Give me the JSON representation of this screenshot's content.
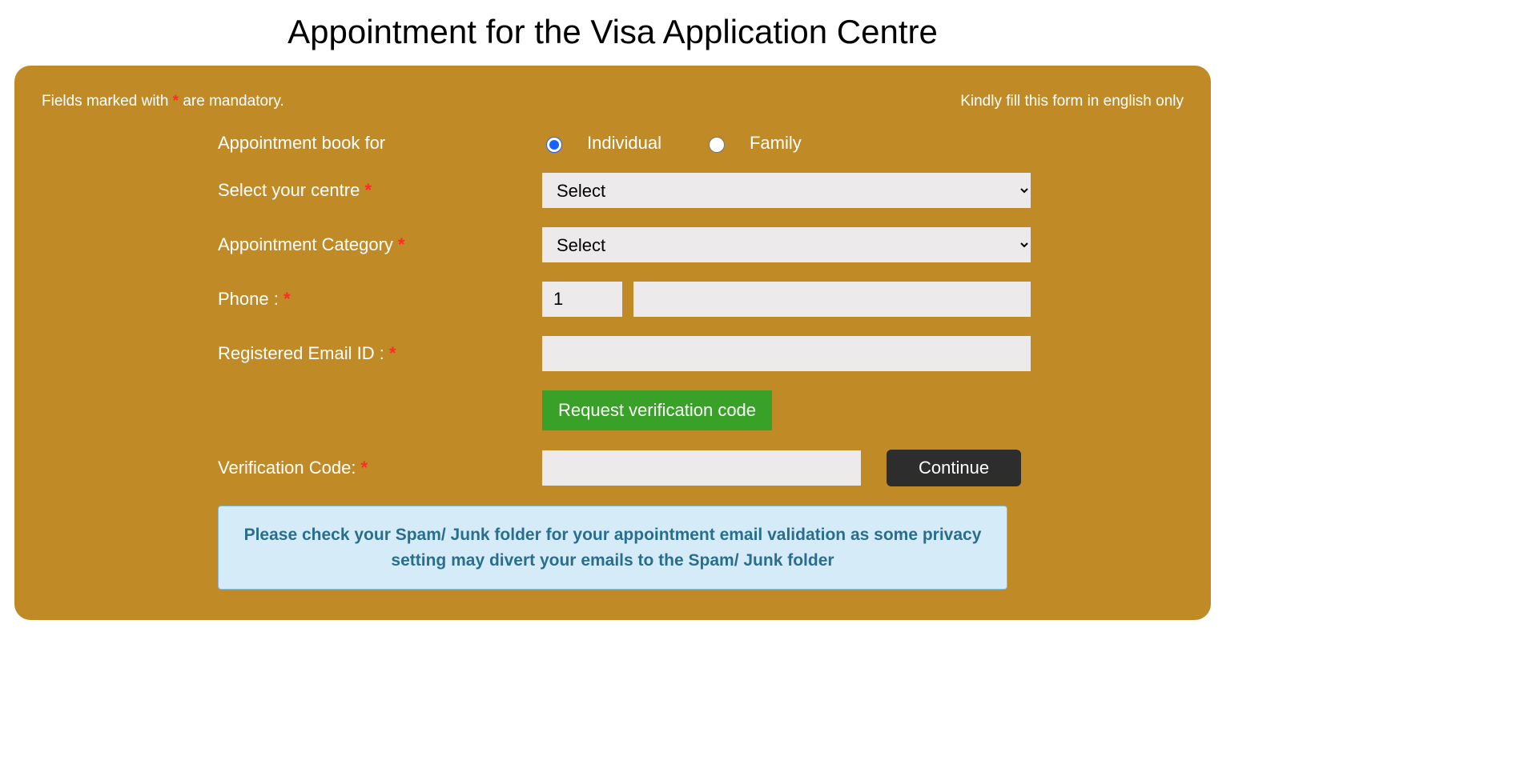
{
  "title": "Appointment for the Visa Application Centre",
  "top": {
    "mandatory_prefix": "Fields marked with ",
    "mandatory_star": "*",
    "mandatory_suffix": " are mandatory.",
    "english_note": "Kindly fill this form in english only"
  },
  "labels": {
    "book_for": "Appointment book for",
    "centre": "Select your centre ",
    "category": "Appointment Category ",
    "phone": "Phone : ",
    "email": "Registered Email ID : ",
    "code": "Verification Code: "
  },
  "radios": {
    "individual": "Individual",
    "family": "Family"
  },
  "selects": {
    "centre_placeholder": "Select",
    "category_placeholder": "Select"
  },
  "phone": {
    "country_code": "1",
    "number": ""
  },
  "email": {
    "value": ""
  },
  "buttons": {
    "request_code": "Request verification code",
    "continue": "Continue"
  },
  "code": {
    "value": ""
  },
  "info": "Please check your Spam/ Junk folder for your appointment email validation as some privacy setting may divert your emails to the Spam/ Junk folder"
}
